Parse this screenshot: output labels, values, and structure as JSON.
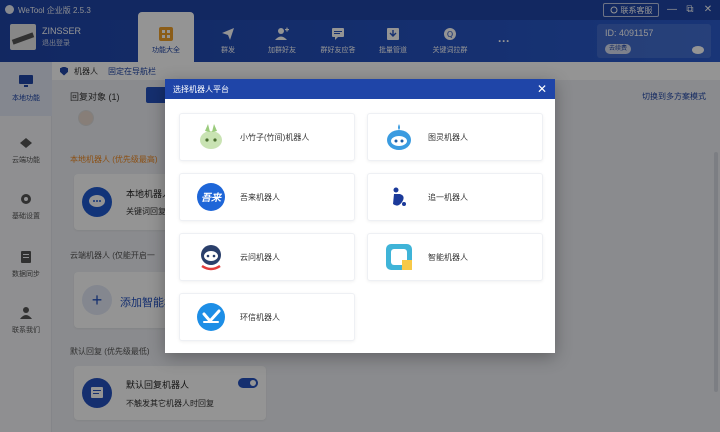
{
  "titlebar": {
    "title": "WeTool 企业版 2.5.3",
    "support": "联系客服",
    "min": "—",
    "restore": "⧉",
    "close": "✕"
  },
  "user": {
    "name": "ZINSSER",
    "sub": "退出登录"
  },
  "nav": [
    {
      "label": "功能大全",
      "icon": "apps-icon",
      "active": true
    },
    {
      "label": "群发",
      "icon": "send-icon"
    },
    {
      "label": "加群好友",
      "icon": "add-friend-icon"
    },
    {
      "label": "群好友应答",
      "icon": "chat-icon"
    },
    {
      "label": "批量管道",
      "icon": "download-icon"
    },
    {
      "label": "关键词拉群",
      "icon": "keyword-icon"
    },
    {
      "label": "···",
      "icon": "more-icon"
    }
  ],
  "account": {
    "id": "ID: 4091157",
    "badge": "去续费"
  },
  "sidebar": [
    {
      "label": "本地功能",
      "active": true
    },
    {
      "label": "云端功能"
    },
    {
      "label": "基础设置"
    },
    {
      "label": "数据同步"
    },
    {
      "label": "联系我们"
    }
  ],
  "crumb": {
    "title": "机器人",
    "pin": "固定在导航栏"
  },
  "main": {
    "reply_target": "回复对象 (1)",
    "switch_link": "切换到多方案模式",
    "orange_label": "本地机器人 (优先级最高)",
    "local_card": {
      "title": "本地机器人",
      "sub": "关键词回复"
    },
    "cloud_label": "云端机器人 (仅能开启一",
    "add_card": {
      "title": "添加智能机"
    },
    "default_label": "默认回复 (优先级最低)",
    "default_card": {
      "title": "默认回复机器人",
      "sub": "不触发其它机器人时回复"
    }
  },
  "modal": {
    "title": "选择机器人平台",
    "close": "✕",
    "options": [
      {
        "name": "小竹子(竹间)机器人",
        "icon": "bamboo-robot-icon"
      },
      {
        "name": "图灵机器人",
        "icon": "turing-robot-icon"
      },
      {
        "name": "吾来机器人",
        "icon": "wulai-robot-icon",
        "logo_text": "吾来"
      },
      {
        "name": "追一机器人",
        "icon": "zhuiyi-robot-icon"
      },
      {
        "name": "云问机器人",
        "icon": "yunwen-robot-icon"
      },
      {
        "name": "智能机器人",
        "icon": "smart-robot-icon"
      },
      {
        "name": "环信机器人",
        "icon": "huanxin-robot-icon"
      }
    ]
  }
}
